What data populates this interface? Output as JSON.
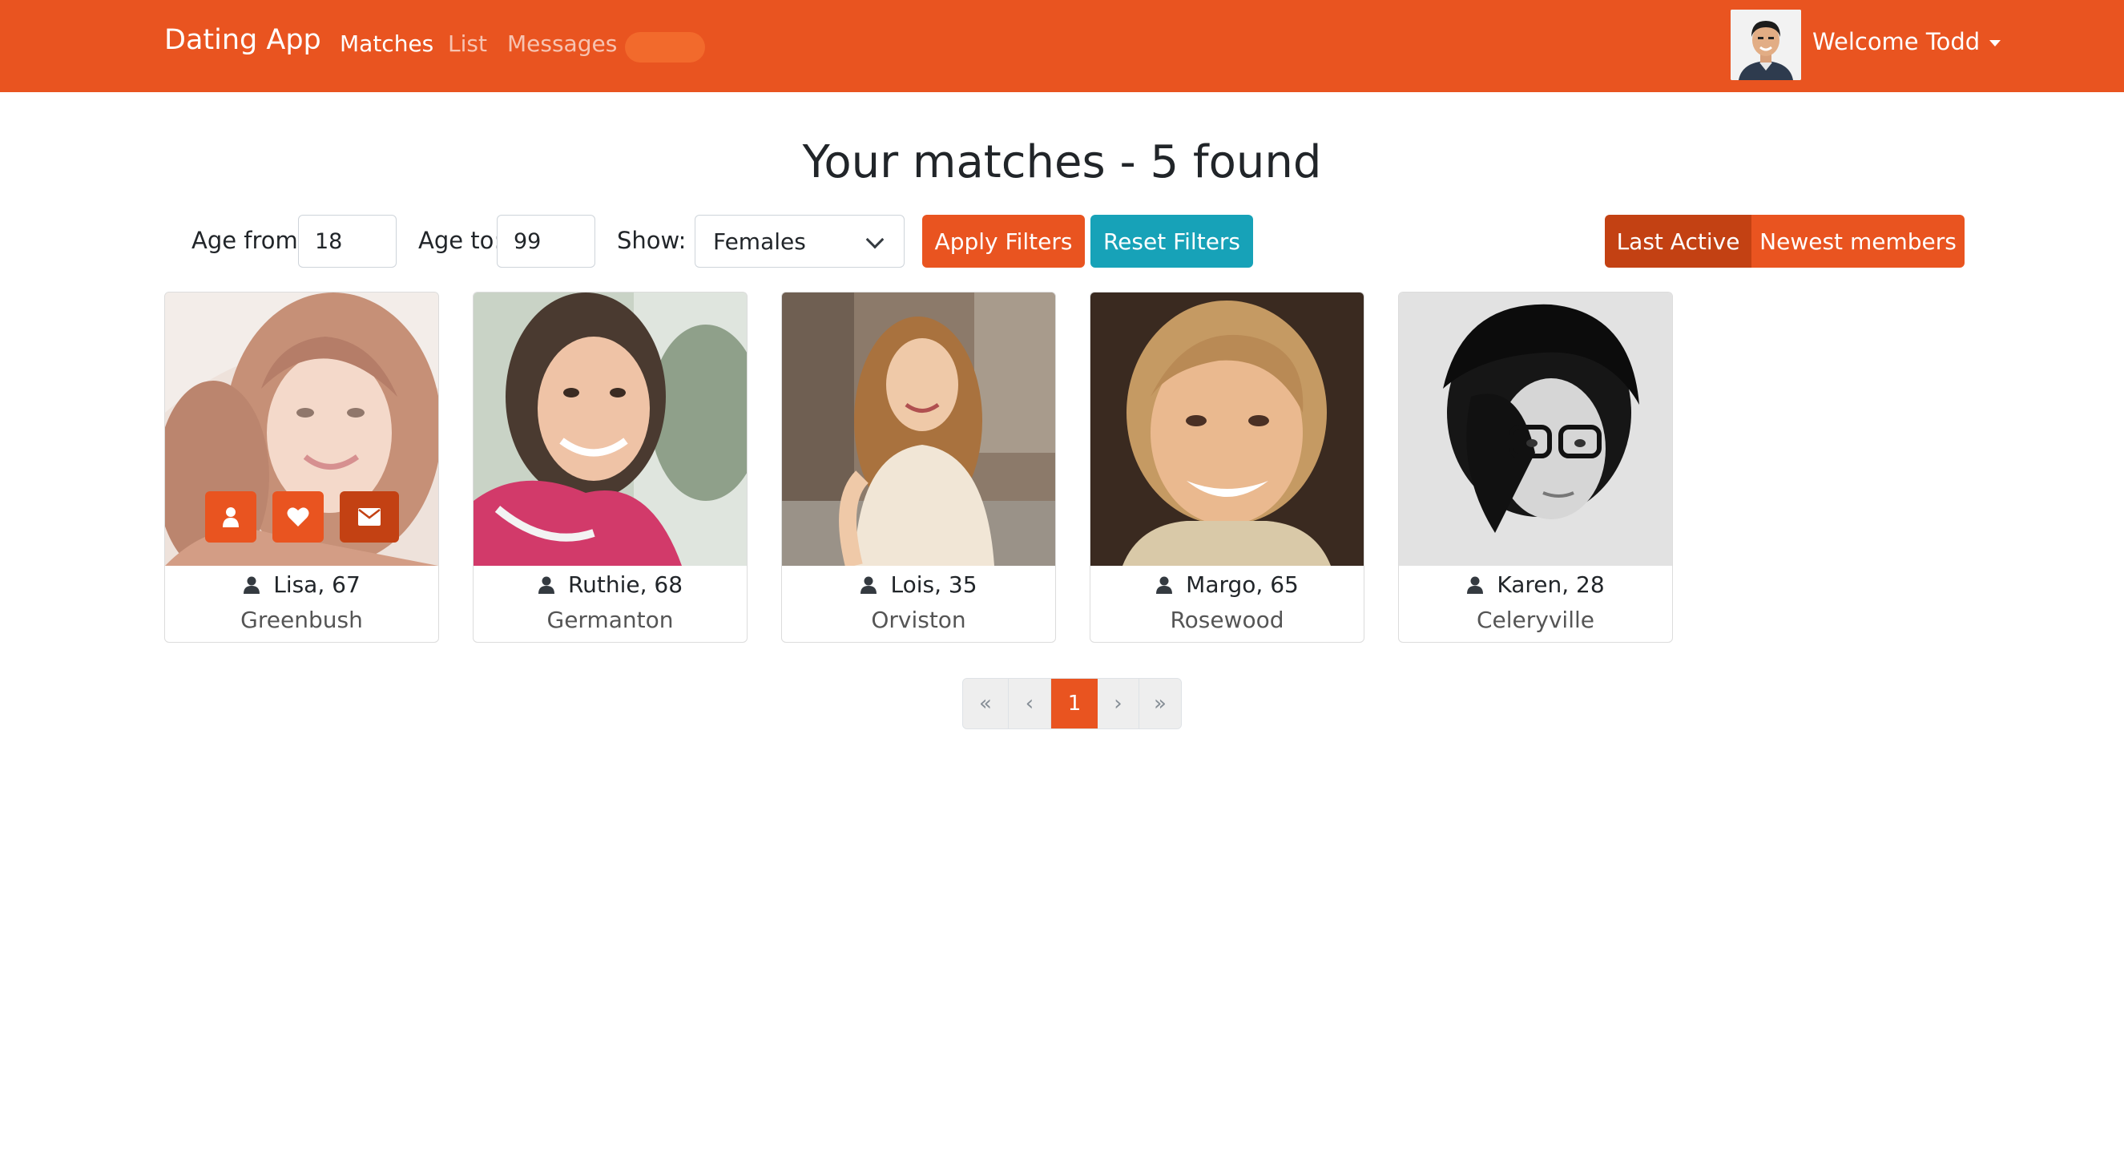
{
  "navbar": {
    "brand": "Dating App",
    "links": [
      {
        "label": "Matches",
        "active": true
      },
      {
        "label": "List",
        "active": false
      },
      {
        "label": "Messages",
        "active": false
      }
    ],
    "user": {
      "welcome": "Welcome Todd"
    },
    "brand_color": "#e95420"
  },
  "page": {
    "title": "Your matches - 5 found"
  },
  "filters": {
    "age_from_label": "Age from:",
    "age_from_value": "18",
    "age_to_label": "Age to:",
    "age_to_value": "99",
    "show_label": "Show:",
    "show_value": "Females",
    "apply_label": "Apply Filters",
    "reset_label": "Reset Filters"
  },
  "sort": {
    "last_active_label": "Last Active",
    "newest_label": "Newest members",
    "selected": "Last Active"
  },
  "members": [
    {
      "name": "Lisa, 67",
      "city": "Greenbush",
      "photo": "photo-lisa"
    },
    {
      "name": "Ruthie, 68",
      "city": "Germanton",
      "photo": "photo-ruthie"
    },
    {
      "name": "Lois, 35",
      "city": "Orviston",
      "photo": "photo-lois"
    },
    {
      "name": "Margo, 65",
      "city": "Rosewood",
      "photo": "photo-margo"
    },
    {
      "name": "Karen, 28",
      "city": "Celeryville",
      "photo": "photo-karen"
    }
  ],
  "pagination": {
    "first": "«",
    "prev": "‹",
    "current": "1",
    "next": "›",
    "last": "»"
  },
  "colors": {
    "primary": "#e95420",
    "primary_dark": "#c34113",
    "info": "#17a2b8"
  }
}
